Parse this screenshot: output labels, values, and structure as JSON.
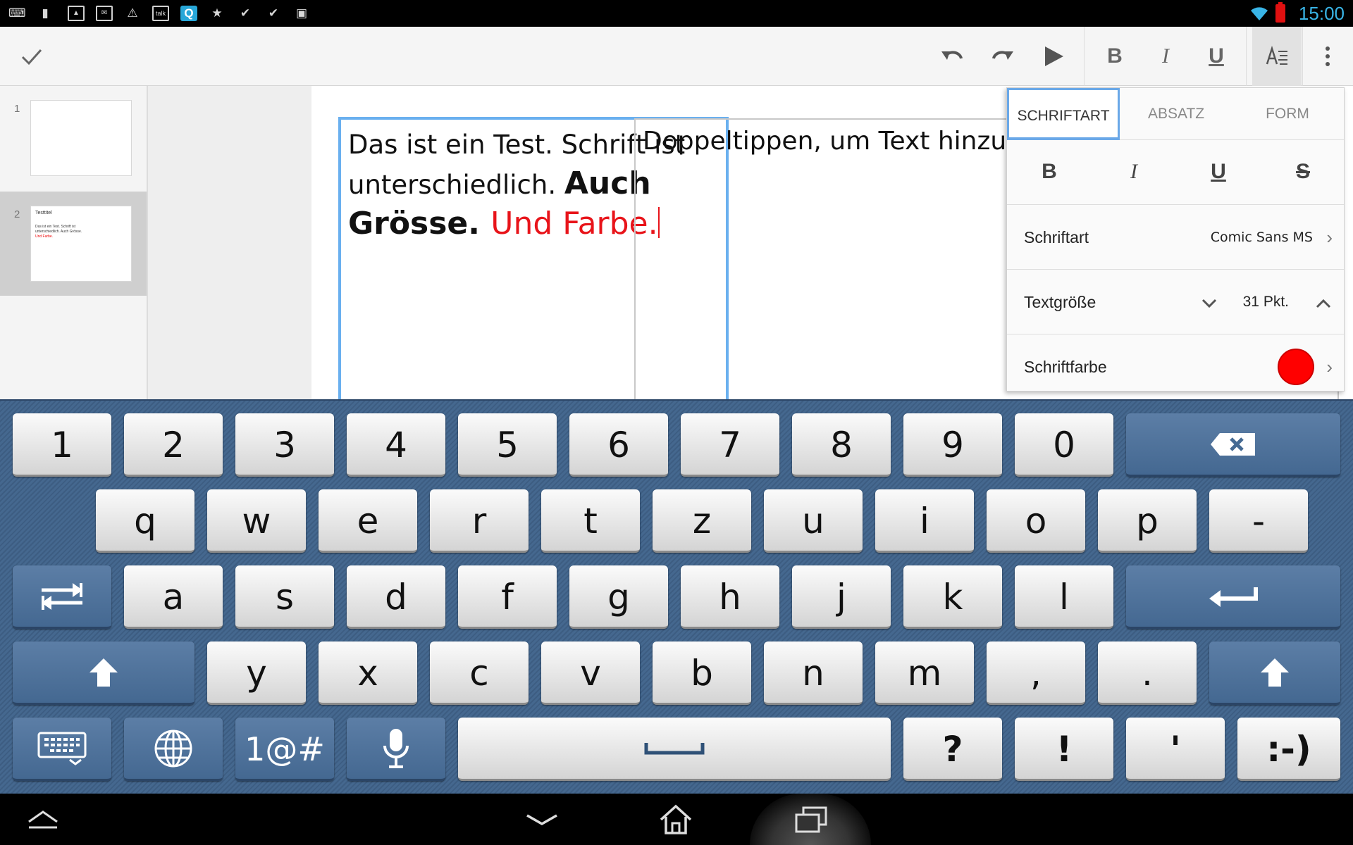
{
  "status_bar": {
    "time": "15:00",
    "left_icons": [
      "keyboard-icon",
      "sim-icon",
      "gallery-icon",
      "gmail-icon",
      "warning-icon",
      "talk-icon",
      "quickoffice-icon",
      "star-icon",
      "bag-check-icon",
      "bag-check-icon",
      "shop-bag-icon"
    ],
    "talk_label": "talk",
    "q_label": "Q"
  },
  "toolbar": {
    "done_icon": "check-icon",
    "undo_icon": "undo-icon",
    "redo_icon": "redo-icon",
    "play_icon": "play-icon",
    "bold_label": "B",
    "italic_label": "I",
    "underline_label": "U",
    "format_icon": "text-format-icon",
    "more_icon": "overflow-icon"
  },
  "slides": {
    "items": [
      {
        "number": "1",
        "title": "",
        "body": ""
      },
      {
        "number": "2",
        "title": "Testtitel",
        "body_plain": "Das ist ein Test. Schrift ist unterschiedlich. Auch Grösse.",
        "body_red": "Und Farbe."
      }
    ]
  },
  "canvas": {
    "textbox1": {
      "line1": "Das ist ein Test. ",
      "line1b": "Schrift ist unterschiedlich. ",
      "big": "Auch Grösse. ",
      "red": "Und Farbe."
    },
    "textbox2": {
      "placeholder": "Doppeltippen, um Text hinzuzufügen"
    }
  },
  "format_panel": {
    "tabs": [
      {
        "label": "SCHRIFTART",
        "active": true
      },
      {
        "label": "ABSATZ",
        "active": false
      },
      {
        "label": "FORM",
        "active": false
      }
    ],
    "styles": {
      "bold": "B",
      "italic": "I",
      "underline": "U",
      "strike": "S"
    },
    "font": {
      "label": "Schriftart",
      "value": "Comic Sans MS"
    },
    "size": {
      "label": "Textgröße",
      "value": "31 Pkt."
    },
    "color": {
      "label": "Schriftfarbe",
      "value": "#ff0000"
    }
  },
  "keyboard": {
    "row1": [
      "1",
      "2",
      "3",
      "4",
      "5",
      "6",
      "7",
      "8",
      "9",
      "0"
    ],
    "row2": [
      "q",
      "w",
      "e",
      "r",
      "t",
      "z",
      "u",
      "i",
      "o",
      "p",
      "-"
    ],
    "row3": [
      "a",
      "s",
      "d",
      "f",
      "g",
      "h",
      "j",
      "k",
      "l"
    ],
    "row4": [
      "y",
      "x",
      "c",
      "v",
      "b",
      "n",
      "m",
      ",",
      "."
    ],
    "row5": {
      "symbols": "1@#",
      "question": "?",
      "exclaim": "!",
      "apostrophe": "'",
      "smiley": ":-)"
    }
  },
  "colors": {
    "accent_blue": "#6ab0ef",
    "text_red": "#e8141a",
    "keyboard_bg": "#3d5d82",
    "clock_blue": "#39b4e6"
  }
}
